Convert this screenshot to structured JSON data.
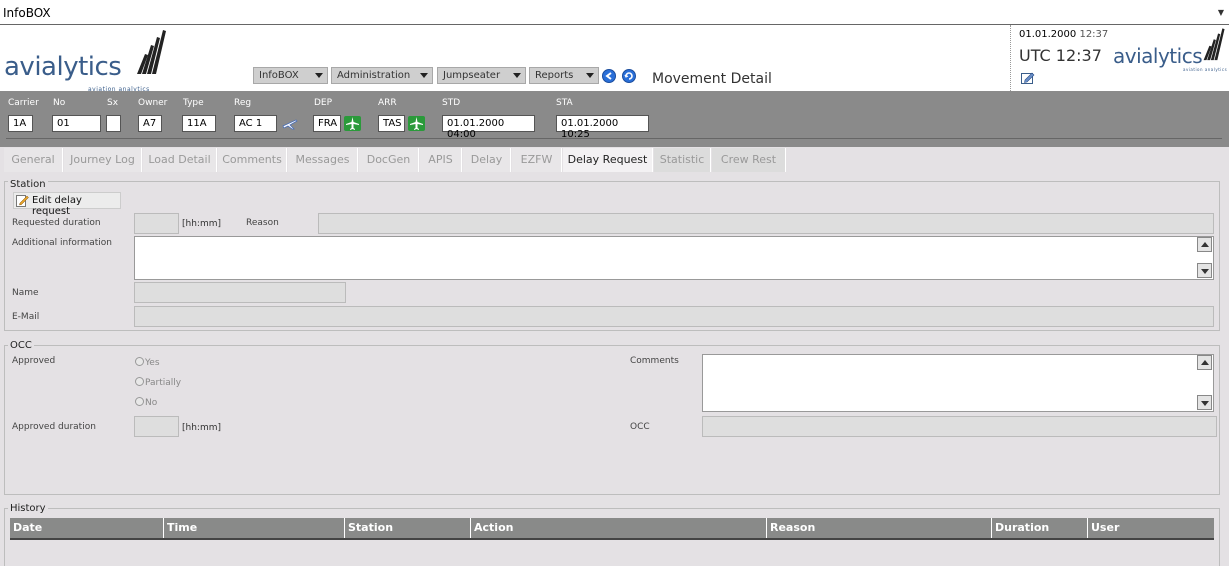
{
  "window": {
    "title": "InfoBOX",
    "menu_glyph": "▼"
  },
  "brand": {
    "word": "avialytics",
    "tagline": "aviation analytics"
  },
  "nav": {
    "menus": [
      "InfoBOX",
      "Administration",
      "Jumpseater",
      "Reports"
    ],
    "back_icon": "back-arrow-icon",
    "refresh_icon": "refresh-icon",
    "page_title": "Movement Detail"
  },
  "clock": {
    "date": "01.01.2000",
    "time": "12:37",
    "utc_label": "UTC 12:37"
  },
  "flight": {
    "labels": {
      "carrier": "Carrier",
      "no": "No",
      "sx": "Sx",
      "owner": "Owner",
      "type": "Type",
      "reg": "Reg",
      "dep": "DEP",
      "arr": "ARR",
      "std": "STD",
      "sta": "STA"
    },
    "values": {
      "carrier": "1A",
      "no": "01",
      "sx": "",
      "owner": "A7",
      "type": "11A",
      "reg": "AC 1",
      "dep": "FRA",
      "arr": "TAS",
      "std": "01.01.2000 04:00",
      "sta": "01.01.2000 10:25"
    }
  },
  "tabs": [
    "General",
    "Journey Log",
    "Load Detail",
    "Comments",
    "Messages",
    "DocGen",
    "APIS",
    "Delay",
    "EZFW",
    "Delay Request",
    "Statistic",
    "Crew Rest"
  ],
  "active_tab": "Delay Request",
  "station": {
    "legend": "Station",
    "edit_button": "Edit delay request",
    "requested_duration_label": "Requested duration",
    "unit": "[hh:mm]",
    "reason_label": "Reason",
    "additional_info_label": "Additional information",
    "name_label": "Name",
    "email_label": "E-Mail"
  },
  "occ": {
    "legend": "OCC",
    "approved_label": "Approved",
    "options": [
      "Yes",
      "Partially",
      "No"
    ],
    "approved_duration_label": "Approved duration",
    "unit": "[hh:mm]",
    "comments_label": "Comments",
    "occ_label": "OCC"
  },
  "history": {
    "legend": "History",
    "columns": [
      "Date",
      "Time",
      "Station",
      "Action",
      "Reason",
      "Duration",
      "User"
    ]
  },
  "colors": {
    "brand": "#3a5d8a",
    "flightbar": "#8a8a8a",
    "airport_green": "#2a9a3a",
    "nav_blue": "#2a6fd8"
  }
}
